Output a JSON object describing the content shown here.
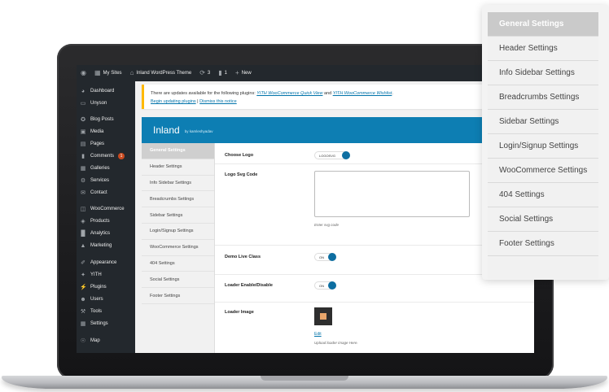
{
  "adminbar": {
    "site_label": "My Sites",
    "theme_label": "Inland WordPress Theme",
    "updates_count": "3",
    "comments_count": "1",
    "new_label": "New"
  },
  "adminmenu": {
    "items": [
      {
        "label": "Dashboard",
        "icon": "dashboard-icon"
      },
      {
        "label": "Unyson",
        "icon": "unyson-icon"
      },
      {
        "label": "Blog Posts",
        "icon": "pin-icon"
      },
      {
        "label": "Media",
        "icon": "media-icon"
      },
      {
        "label": "Pages",
        "icon": "pages-icon"
      },
      {
        "label": "Comments",
        "icon": "comments-icon",
        "badge": "1"
      },
      {
        "label": "Galleries",
        "icon": "gallery-icon"
      },
      {
        "label": "Services",
        "icon": "services-icon"
      },
      {
        "label": "Contact",
        "icon": "contact-icon"
      },
      {
        "label": "WooCommerce",
        "icon": "woocommerce-icon"
      },
      {
        "label": "Products",
        "icon": "products-icon"
      },
      {
        "label": "Analytics",
        "icon": "analytics-icon"
      },
      {
        "label": "Marketing",
        "icon": "marketing-icon"
      },
      {
        "label": "Appearance",
        "icon": "appearance-icon"
      },
      {
        "label": "YITH",
        "icon": "yith-icon"
      },
      {
        "label": "Plugins",
        "icon": "plugins-icon"
      },
      {
        "label": "Users",
        "icon": "users-icon"
      },
      {
        "label": "Tools",
        "icon": "tools-icon"
      },
      {
        "label": "Settings",
        "icon": "settings-icon"
      },
      {
        "label": "Map",
        "icon": "map-icon"
      }
    ]
  },
  "notice": {
    "text_before": "There are updates available for the following plugins: ",
    "plugin_1": "YITH WooCommerce Quick View",
    "text_and": " and ",
    "plugin_2": "YITH WooCommerce Wishlist",
    "text_end": ".",
    "begin_link": "Begin updating plugins",
    "separator": " | ",
    "dismiss_link": "Dismiss this notice"
  },
  "panel": {
    "brand": "Inland",
    "byline": "by kamleshyadav"
  },
  "subnav": {
    "items": [
      "General Settings",
      "Header Settings",
      "Info Sidebar Settings",
      "Breadcrumbs Settings",
      "Sidebar Settings",
      "Login/Signup Settings",
      "WooCommerce Settings",
      "404 Settings",
      "Social Settings",
      "Footer Settings"
    ],
    "active_index": 0
  },
  "form": {
    "choose_logo_label": "Choose Logo",
    "choose_logo_value": "LOGOSVG",
    "logo_svg_label": "Logo Svg Code",
    "logo_svg_help": "Enter svg code",
    "demo_live_label": "Demo Live Class",
    "demo_live_value": "ON",
    "loader_enable_label": "Loader Enable/Disable",
    "loader_enable_value": "ON",
    "loader_image_label": "Loader Image",
    "edit_link": "Edit",
    "loader_help": "Upload loader image Here."
  },
  "float_menu": {
    "items": [
      "General Settings",
      "Header Settings",
      "Info Sidebar Settings",
      "Breadcrumbs Settings",
      "Sidebar Settings",
      "Login/Signup Settings",
      "WooCommerce Settings",
      "404 Settings",
      "Social Settings",
      "Footer Settings"
    ],
    "active_index": 0
  },
  "colors": {
    "accent": "#0d7eb3",
    "admin_dark": "#23282d",
    "notice_border": "#ffb900",
    "badge": "#ca4a1f"
  }
}
